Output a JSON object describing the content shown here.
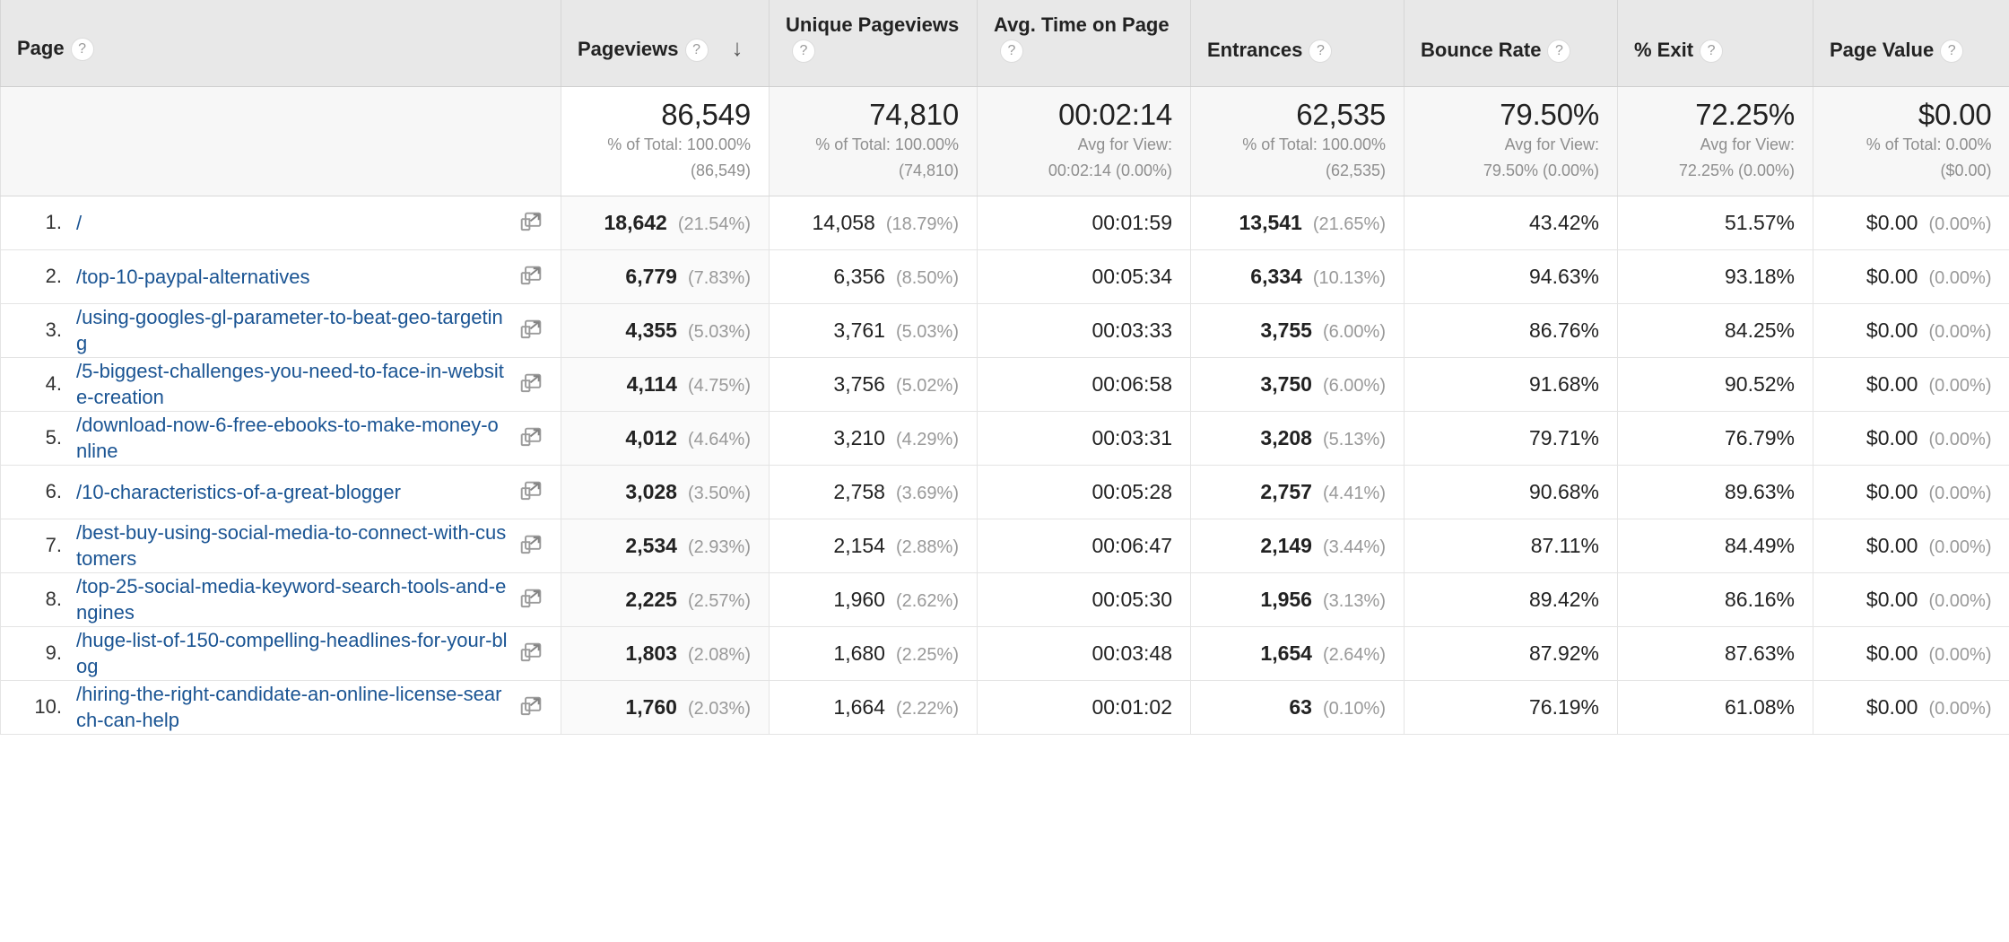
{
  "table": {
    "columns": [
      {
        "key": "page",
        "label": "Page",
        "help": "?",
        "sorted": false
      },
      {
        "key": "pv",
        "label": "Pageviews",
        "help": "?",
        "sorted": true,
        "sort_arrow": "↓"
      },
      {
        "key": "upv",
        "label": "Unique Pageviews",
        "help": "?",
        "sorted": false
      },
      {
        "key": "time",
        "label": "Avg. Time on Page",
        "help": "?",
        "sorted": false
      },
      {
        "key": "entr",
        "label": "Entrances",
        "help": "?",
        "sorted": false
      },
      {
        "key": "bounce",
        "label": "Bounce Rate",
        "help": "?",
        "sorted": false
      },
      {
        "key": "exit",
        "label": "% Exit",
        "help": "?",
        "sorted": false
      },
      {
        "key": "value",
        "label": "Page Value",
        "help": "?",
        "sorted": false
      }
    ],
    "summary": {
      "pv": {
        "value": "86,549",
        "line1": "% of Total: 100.00%",
        "line2": "(86,549)"
      },
      "upv": {
        "value": "74,810",
        "line1": "% of Total: 100.00%",
        "line2": "(74,810)"
      },
      "time": {
        "value": "00:02:14",
        "line1": "Avg for View:",
        "line2": "00:02:14 (0.00%)"
      },
      "entr": {
        "value": "62,535",
        "line1": "% of Total: 100.00%",
        "line2": "(62,535)"
      },
      "bounce": {
        "value": "79.50%",
        "line1": "Avg for View:",
        "line2": "79.50% (0.00%)"
      },
      "exit": {
        "value": "72.25%",
        "line1": "Avg for View:",
        "line2": "72.25% (0.00%)"
      },
      "value": {
        "value": "$0.00",
        "line1": "% of Total: 0.00%",
        "line2": "($0.00)"
      }
    },
    "rows": [
      {
        "rank": "1.",
        "page": "/",
        "pv": "18,642",
        "pv_pct": "(21.54%)",
        "upv": "14,058",
        "upv_pct": "(18.79%)",
        "time": "00:01:59",
        "entr": "13,541",
        "entr_pct": "(21.65%)",
        "bounce": "43.42%",
        "exit": "51.57%",
        "value": "$0.00",
        "value_pct": "(0.00%)"
      },
      {
        "rank": "2.",
        "page": "/top-10-paypal-alternatives",
        "pv": "6,779",
        "pv_pct": "(7.83%)",
        "upv": "6,356",
        "upv_pct": "(8.50%)",
        "time": "00:05:34",
        "entr": "6,334",
        "entr_pct": "(10.13%)",
        "bounce": "94.63%",
        "exit": "93.18%",
        "value": "$0.00",
        "value_pct": "(0.00%)"
      },
      {
        "rank": "3.",
        "page": "/using-googles-gl-parameter-to-beat-geo-targeting",
        "pv": "4,355",
        "pv_pct": "(5.03%)",
        "upv": "3,761",
        "upv_pct": "(5.03%)",
        "time": "00:03:33",
        "entr": "3,755",
        "entr_pct": "(6.00%)",
        "bounce": "86.76%",
        "exit": "84.25%",
        "value": "$0.00",
        "value_pct": "(0.00%)"
      },
      {
        "rank": "4.",
        "page": "/5-biggest-challenges-you-need-to-face-in-website-creation",
        "pv": "4,114",
        "pv_pct": "(4.75%)",
        "upv": "3,756",
        "upv_pct": "(5.02%)",
        "time": "00:06:58",
        "entr": "3,750",
        "entr_pct": "(6.00%)",
        "bounce": "91.68%",
        "exit": "90.52%",
        "value": "$0.00",
        "value_pct": "(0.00%)"
      },
      {
        "rank": "5.",
        "page": "/download-now-6-free-ebooks-to-make-money-online",
        "pv": "4,012",
        "pv_pct": "(4.64%)",
        "upv": "3,210",
        "upv_pct": "(4.29%)",
        "time": "00:03:31",
        "entr": "3,208",
        "entr_pct": "(5.13%)",
        "bounce": "79.71%",
        "exit": "76.79%",
        "value": "$0.00",
        "value_pct": "(0.00%)"
      },
      {
        "rank": "6.",
        "page": "/10-characteristics-of-a-great-blogger",
        "pv": "3,028",
        "pv_pct": "(3.50%)",
        "upv": "2,758",
        "upv_pct": "(3.69%)",
        "time": "00:05:28",
        "entr": "2,757",
        "entr_pct": "(4.41%)",
        "bounce": "90.68%",
        "exit": "89.63%",
        "value": "$0.00",
        "value_pct": "(0.00%)"
      },
      {
        "rank": "7.",
        "page": "/best-buy-using-social-media-to-connect-with-customers",
        "pv": "2,534",
        "pv_pct": "(2.93%)",
        "upv": "2,154",
        "upv_pct": "(2.88%)",
        "time": "00:06:47",
        "entr": "2,149",
        "entr_pct": "(3.44%)",
        "bounce": "87.11%",
        "exit": "84.49%",
        "value": "$0.00",
        "value_pct": "(0.00%)"
      },
      {
        "rank": "8.",
        "page": "/top-25-social-media-keyword-search-tools-and-engines",
        "pv": "2,225",
        "pv_pct": "(2.57%)",
        "upv": "1,960",
        "upv_pct": "(2.62%)",
        "time": "00:05:30",
        "entr": "1,956",
        "entr_pct": "(3.13%)",
        "bounce": "89.42%",
        "exit": "86.16%",
        "value": "$0.00",
        "value_pct": "(0.00%)"
      },
      {
        "rank": "9.",
        "page": "/huge-list-of-150-compelling-headlines-for-your-blog",
        "pv": "1,803",
        "pv_pct": "(2.08%)",
        "upv": "1,680",
        "upv_pct": "(2.25%)",
        "time": "00:03:48",
        "entr": "1,654",
        "entr_pct": "(2.64%)",
        "bounce": "87.92%",
        "exit": "87.63%",
        "value": "$0.00",
        "value_pct": "(0.00%)"
      },
      {
        "rank": "10.",
        "page": "/hiring-the-right-candidate-an-online-license-search-can-help",
        "pv": "1,760",
        "pv_pct": "(2.03%)",
        "upv": "1,664",
        "upv_pct": "(2.22%)",
        "time": "00:01:02",
        "entr": "63",
        "entr_pct": "(0.10%)",
        "bounce": "76.19%",
        "exit": "61.08%",
        "value": "$0.00",
        "value_pct": "(0.00%)"
      }
    ]
  },
  "icons": {
    "external_link": "open-in-new-window-icon",
    "help": "help-question-icon",
    "sort_desc": "sort-descending-arrow-icon"
  },
  "colors": {
    "link": "#1a5493",
    "header_bg": "#e8e8e8",
    "summary_bg": "#f7f7f7",
    "muted_text": "#999999"
  }
}
